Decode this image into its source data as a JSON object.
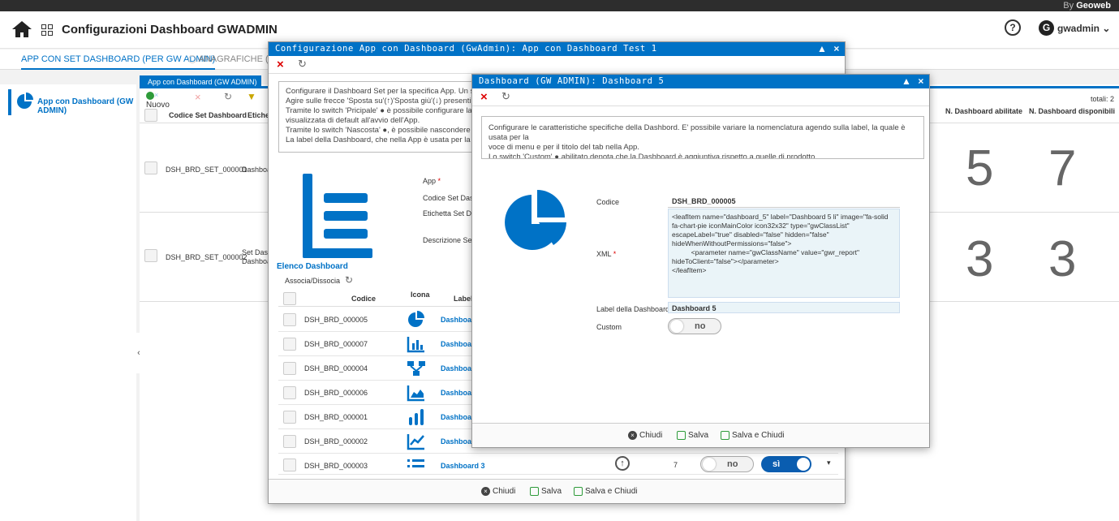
{
  "brand": {
    "prefix": "By",
    "name": "Geoweb"
  },
  "header": {
    "title": "Configurazioni Dashboard GWADMIN",
    "user": "gwadmin",
    "user_initial": "G"
  },
  "main_tabs": [
    {
      "label": "APP CON SET DASHBOARD (PER GW ADMIN)"
    },
    {
      "label": "ANAGRAFICHE (PER G"
    }
  ],
  "sidebar": {
    "items": [
      {
        "label": "App con Dashboard (GW ADMIN)"
      }
    ]
  },
  "inner_tab": {
    "label": "App con Dashboard (GW ADMIN)"
  },
  "toolbar": {
    "new_label": "Nuovo"
  },
  "totals": "totali: 2",
  "table": {
    "columns": [
      "Codice Set Dashboard",
      "Etichet",
      "N. Dashboard abilitate",
      "N. Dashboard disponibili"
    ],
    "rows": [
      {
        "code": "DSH_BRD_SET_000001",
        "label": "Dashboa",
        "enabled": "5",
        "available": "7"
      },
      {
        "code": "DSH_BRD_SET_000002",
        "label": "Set Dash\nDashboa",
        "enabled": "3",
        "available": "3"
      }
    ]
  },
  "dialog1": {
    "title": "Configurazione App con Dashboard (GwAdmin): App con Dashboard Test 1",
    "info": [
      "Configurare il Dashboard Set per la specifica App. Un set di D",
      "Agire sulle frecce 'Sposta su'(↑)'Sposta giù'(↓) presenti in lis",
      "Tramite lo switch 'Pricipale' ● è possibile configurare la Da",
      "visualizzata di default all'avvio dell'App.",
      "Tramite lo switch 'Nascosta' ●, è possibile nascondere nell'",
      "La label della Dashboard, che nella App è usata per la voce d"
    ],
    "fields": {
      "app": "App",
      "code_set": "Codice Set Dashbo",
      "label_set": "Etichetta Set Dash",
      "desc_set": "Descrizione Set Da"
    },
    "list_title": "Elenco Dashboard",
    "assoc_label": "Associa/Dissocia",
    "list_columns": {
      "code": "Codice",
      "icon": "Icona",
      "label": "Label"
    },
    "list": [
      {
        "code": "DSH_BRD_000005",
        "label": "Dashboard",
        "icon": "pie-chart-icon"
      },
      {
        "code": "DSH_BRD_000007",
        "label": "Dashboard",
        "icon": "bar-chart-icon"
      },
      {
        "code": "DSH_BRD_000004",
        "label": "Dashboard",
        "icon": "sitemap-icon"
      },
      {
        "code": "DSH_BRD_000006",
        "label": "Dashboard",
        "icon": "area-chart-icon"
      },
      {
        "code": "DSH_BRD_000001",
        "label": "Dashboard",
        "icon": "column-chart-icon"
      },
      {
        "code": "DSH_BRD_000002",
        "label": "Dashboard",
        "icon": "line-chart-icon"
      },
      {
        "code": "DSH_BRD_000003",
        "label": "Dashboard 3",
        "icon": "list-icon",
        "order": "7",
        "off": "no",
        "on": "sì"
      }
    ],
    "footer": {
      "close": "Chiudi",
      "save": "Salva",
      "save_close": "Salva e Chiudi"
    }
  },
  "dialog2": {
    "title": "Dashboard (GW ADMIN): Dashboard 5",
    "info": [
      "Configurare le caratteristiche specifiche della Dashbord. E' possibile variare la nomenclatura agendo sulla label, la quale è usata per la",
      "voce di menu e per il titolo del tab nella App.",
      "Lo switch 'Custom' ● abilitato denota che la Dashboard è aggiuntiva rispetto a quelle di prodotto."
    ],
    "code_label": "Codice",
    "code_value": "DSH_BRD_000005",
    "xml_label": "XML",
    "xml_value": "<leafItem name=\"dashboard_5\" label=\"Dashboard 5 li\" image=\"fa-solid fa-chart-pie iconMainColor icon32x32\" type=\"gwClassList\" escapeLabel=\"true\" disabled=\"false\" hidden=\"false\" hideWhenWithoutPermissions=\"false\">\n          <parameter name=\"gwClassName\" value=\"gwr_report\" hideToClient=\"false\"></parameter>\n</leafItem>",
    "label_label": "Label della Dashboard",
    "label_value": "Dashboard 5",
    "custom_label": "Custom",
    "custom_value": "no",
    "footer": {
      "close": "Chiudi",
      "save": "Salva",
      "save_close": "Salva e Chiudi"
    }
  },
  "colors": {
    "accent": "#0072c6",
    "danger": "#dd0000",
    "success": "#2e9b3a"
  }
}
